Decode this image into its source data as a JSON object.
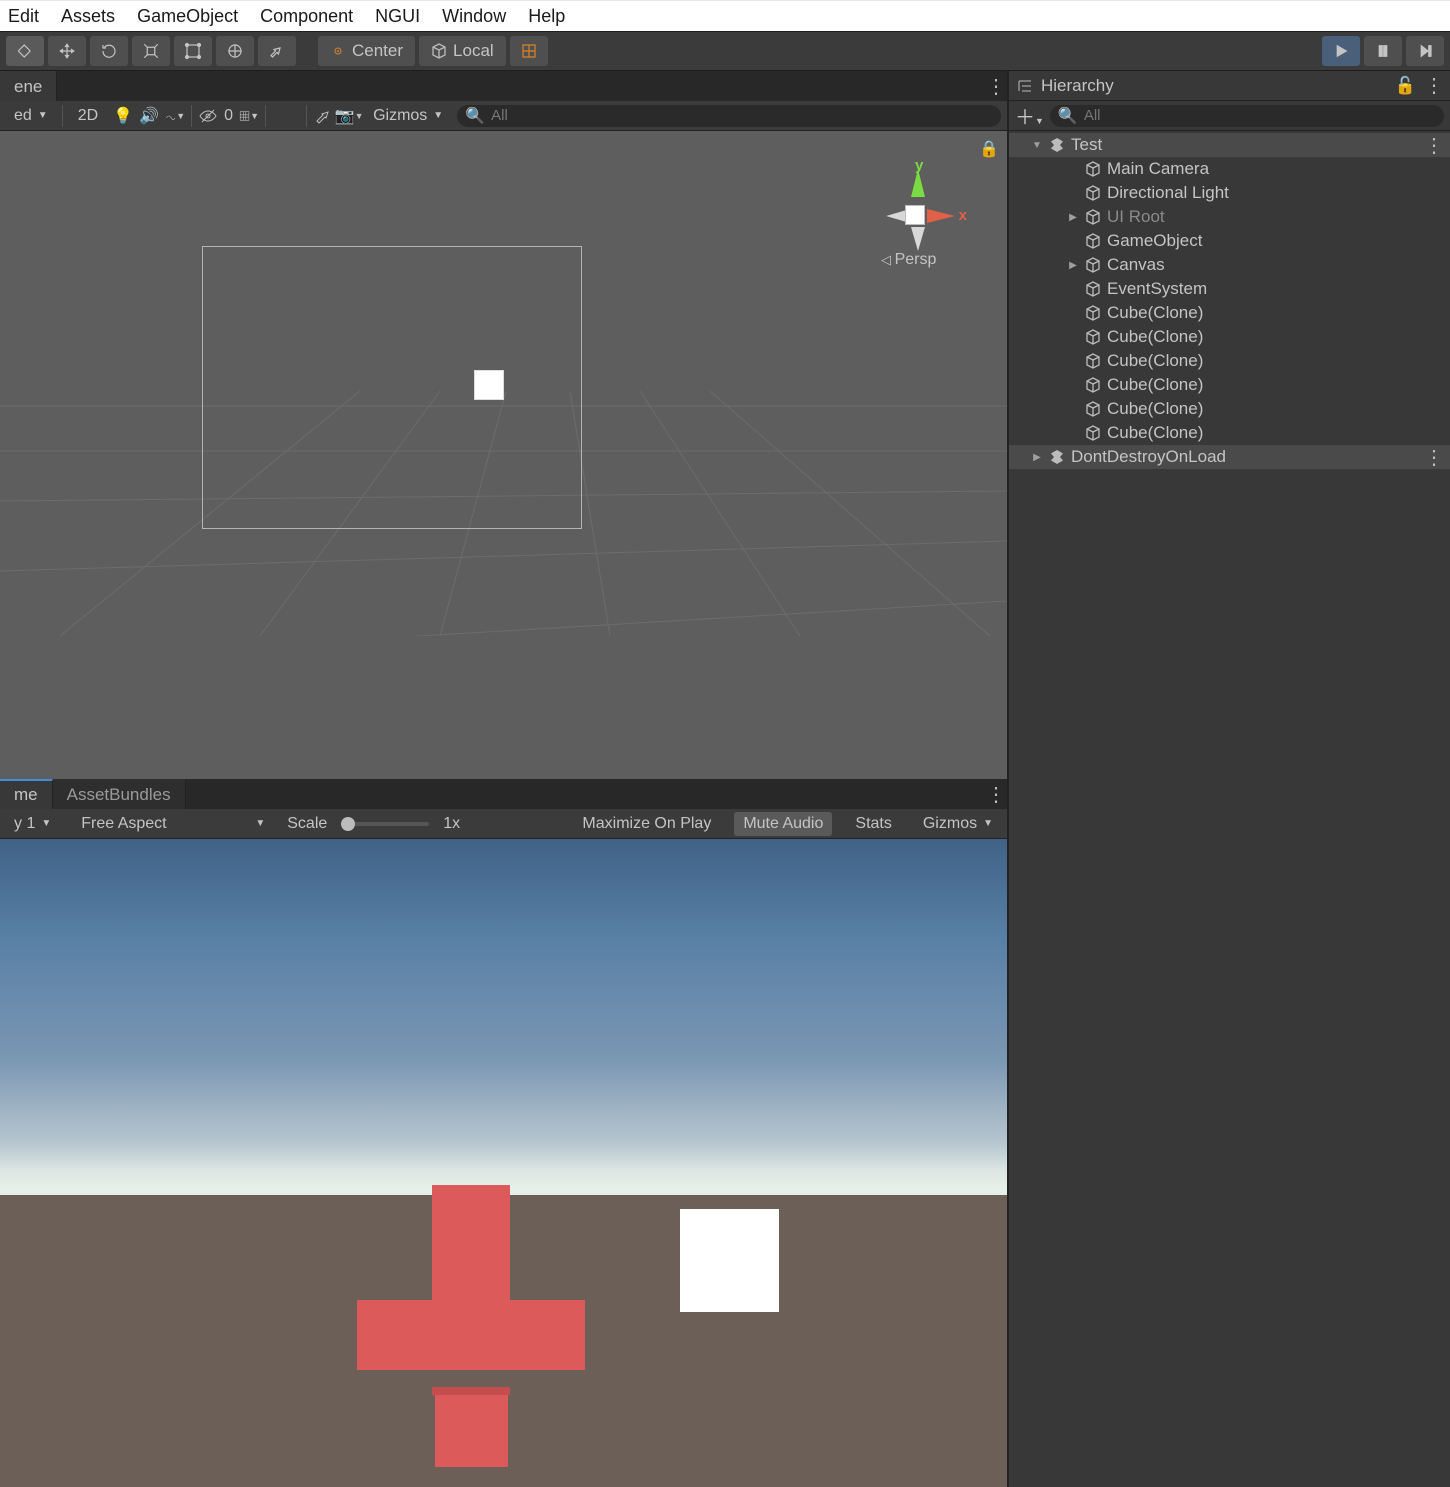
{
  "menu": [
    "Edit",
    "Assets",
    "GameObject",
    "Component",
    "NGUI",
    "Window",
    "Help"
  ],
  "toolbar": {
    "center": "Center",
    "local": "Local"
  },
  "sceneTab": "ene",
  "sceneToolbar": {
    "shaded": "ed",
    "twoD": "2D",
    "hiddenCount": "0",
    "gizmos": "Gizmos",
    "searchPlaceholder": "All"
  },
  "gizmo": {
    "y": "y",
    "x": "x",
    "proj": "Persp"
  },
  "gameTabs": {
    "game": "me",
    "bundles": "AssetBundles"
  },
  "gameTools": {
    "display": "y 1",
    "aspect": "Free Aspect",
    "scaleLabel": "Scale",
    "scaleValue": "1x",
    "maximize": "Maximize On Play",
    "mute": "Mute Audio",
    "stats": "Stats",
    "gizmos": "Gizmos"
  },
  "hierarchy": {
    "title": "Hierarchy",
    "searchPlaceholder": "All",
    "sceneName": "Test",
    "items": [
      {
        "label": "Main Camera",
        "indent": 2,
        "expand": "",
        "dim": false
      },
      {
        "label": "Directional Light",
        "indent": 2,
        "expand": "",
        "dim": false
      },
      {
        "label": "UI Root",
        "indent": 2,
        "expand": "▶",
        "dim": true
      },
      {
        "label": "GameObject",
        "indent": 2,
        "expand": "",
        "dim": false
      },
      {
        "label": "Canvas",
        "indent": 2,
        "expand": "▶",
        "dim": false
      },
      {
        "label": "EventSystem",
        "indent": 2,
        "expand": "",
        "dim": false
      },
      {
        "label": "Cube(Clone)",
        "indent": 2,
        "expand": "",
        "dim": false
      },
      {
        "label": "Cube(Clone)",
        "indent": 2,
        "expand": "",
        "dim": false
      },
      {
        "label": "Cube(Clone)",
        "indent": 2,
        "expand": "",
        "dim": false
      },
      {
        "label": "Cube(Clone)",
        "indent": 2,
        "expand": "",
        "dim": false
      },
      {
        "label": "Cube(Clone)",
        "indent": 2,
        "expand": "",
        "dim": false
      },
      {
        "label": "Cube(Clone)",
        "indent": 2,
        "expand": "",
        "dim": false
      }
    ],
    "dontDestroy": "DontDestroyOnLoad"
  }
}
